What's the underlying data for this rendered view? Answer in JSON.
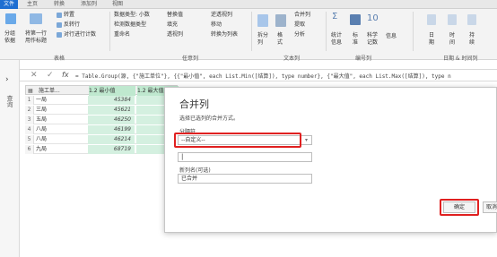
{
  "colors": {
    "accent": "#1f6fd1",
    "highlight": "#e02020",
    "selected_column": "#d4f0e0"
  },
  "tabs": [
    "文件",
    "主页",
    "转换",
    "添加列",
    "视图"
  ],
  "ribbon": {
    "split_col_label": "分组\n依据",
    "first_row_label": "将第一行\n用作标题",
    "transpose": "转置",
    "reverse_rows": "反转行",
    "count_rows": "对行进行计数",
    "table_group": "表格",
    "data_type": "数据类型: 小数",
    "detect_type": "检测数据类型",
    "rename": "重命名",
    "replace_values": "替换值",
    "fill": "填充",
    "pivot": "透视列",
    "unpivot": "逆透视列",
    "move": "移动",
    "to_list": "转换为列表",
    "any_column_group": "任意列",
    "split_column": "拆分\n列",
    "format": "格\n式",
    "merge_columns": "合并列",
    "extract": "提取",
    "parse": "分析",
    "text_column_group": "文本列",
    "statistics": "统计\n信息",
    "standard": "标\n准",
    "scientific": "科学\n记数",
    "info": "信息",
    "number_column_group": "编号列",
    "date": "日\n期",
    "time": "时\n间",
    "duration": "持\n续",
    "datetime_group": "日期 & 时间列",
    "ten": "10"
  },
  "left_nav": {
    "label": "查询"
  },
  "formula_bar": {
    "fx": "fx",
    "formula": "= Table.Group(源, {\"施工单位\"}, {{\"最小值\", each List.Min([结算]), type number}, {\"最大值\", each List.Max([结算]), type n"
  },
  "grid": {
    "headers": [
      "施工单...",
      "1.2 最小值",
      "1.2 最大值"
    ],
    "rows": [
      {
        "idx": "1",
        "name": "一局",
        "min": "45384"
      },
      {
        "idx": "2",
        "name": "三局",
        "min": "45621"
      },
      {
        "idx": "3",
        "name": "五局",
        "min": "46250"
      },
      {
        "idx": "4",
        "name": "八局",
        "min": "46199"
      },
      {
        "idx": "5",
        "name": "八局",
        "min": "46214"
      },
      {
        "idx": "6",
        "name": "九局",
        "min": "68719"
      }
    ]
  },
  "dialog": {
    "title": "合并列",
    "description": "选择已选列的合并方式。",
    "separator_label": "分隔符",
    "separator_value": "--自定义--",
    "custom_value": "|",
    "new_name_label": "新列名(可选)",
    "new_name_value": "已合并",
    "ok": "确定",
    "cancel": "取消"
  }
}
